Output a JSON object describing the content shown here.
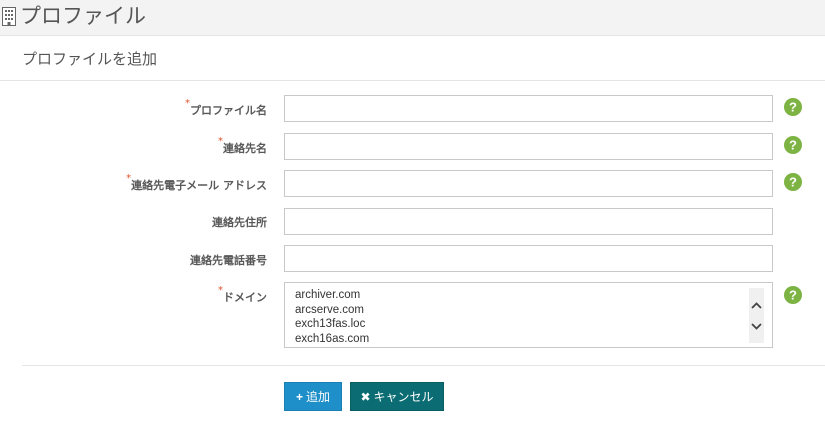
{
  "page": {
    "title": "プロファイル"
  },
  "panel": {
    "title": "プロファイルを追加"
  },
  "form": {
    "fields": [
      {
        "label": "プロファイル名",
        "required": true,
        "value": "",
        "help": true
      },
      {
        "label": "連絡先名",
        "required": true,
        "value": "",
        "help": true
      },
      {
        "label": "連絡先電子メール アドレス",
        "required": true,
        "value": "",
        "help": true
      },
      {
        "label": "連絡先住所",
        "required": false,
        "value": "",
        "help": false
      },
      {
        "label": "連絡先電話番号",
        "required": false,
        "value": "",
        "help": false
      }
    ],
    "domain": {
      "label": "ドメイン",
      "required": true,
      "options": [
        "archiver.com",
        "arcserve.com",
        "exch13fas.loc",
        "exch16as.com"
      ]
    },
    "required_marker": "*"
  },
  "buttons": {
    "add": {
      "icon": "+",
      "label": "追加"
    },
    "cancel": {
      "icon": "✖",
      "label": "キャンセル"
    }
  },
  "colors": {
    "help_icon": "#7cb342",
    "add_button": "#1f8fc9",
    "cancel_button": "#0b6d73",
    "required_marker": "#e0552f"
  },
  "icons": {
    "header": "building-icon",
    "help": "question-circle-icon"
  }
}
